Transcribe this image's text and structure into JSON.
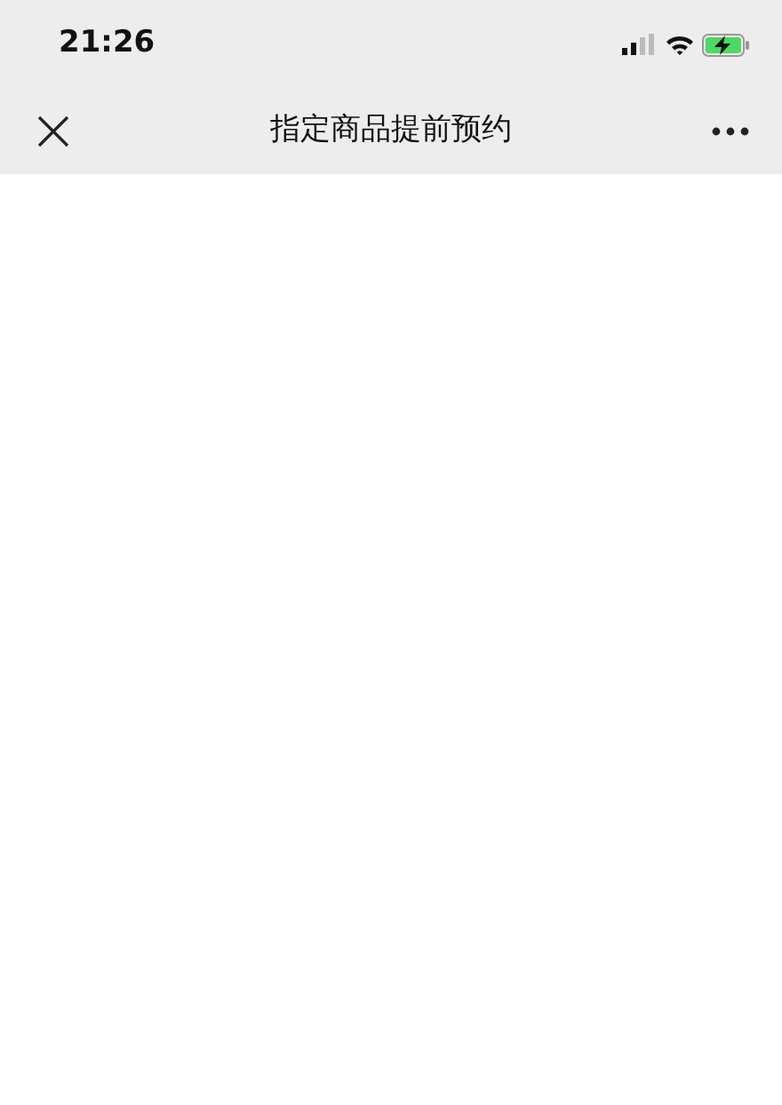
{
  "status_bar": {
    "time": "21:26",
    "charging": true
  },
  "nav_bar": {
    "title": "指定商品提前预约"
  }
}
